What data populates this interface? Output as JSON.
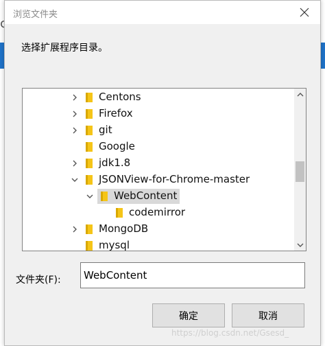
{
  "window": {
    "title": "浏览文件夹",
    "close_icon": "close-icon"
  },
  "instruction": "选择扩展程序目录。",
  "tree": {
    "items": [
      {
        "label": "Centons",
        "expander": "collapsed",
        "level": 0,
        "selected": false
      },
      {
        "label": "Firefox",
        "expander": "collapsed",
        "level": 0,
        "selected": false
      },
      {
        "label": "git",
        "expander": "collapsed",
        "level": 0,
        "selected": false
      },
      {
        "label": "Google",
        "expander": "none",
        "level": 0,
        "selected": false
      },
      {
        "label": "jdk1.8",
        "expander": "collapsed",
        "level": 0,
        "selected": false
      },
      {
        "label": "JSONView-for-Chrome-master",
        "expander": "expanded",
        "level": 0,
        "selected": false
      },
      {
        "label": "WebContent",
        "expander": "expanded",
        "level": 1,
        "selected": true
      },
      {
        "label": "codemirror",
        "expander": "none",
        "level": 2,
        "selected": false
      },
      {
        "label": "MongoDB",
        "expander": "collapsed",
        "level": 0,
        "selected": false
      },
      {
        "label": "mysql",
        "expander": "none",
        "level": 0,
        "selected": false
      }
    ],
    "scroll_position": 0.52
  },
  "folder_field": {
    "label": "文件夹(F):",
    "value": "WebContent"
  },
  "buttons": {
    "ok": "确定",
    "cancel": "取消"
  },
  "watermark": "https://blog.csdn.net/Gsesd_",
  "colors": {
    "folder": "#f5c518",
    "selection": "#d9d9d9",
    "accent_blue": "#1f73c9"
  }
}
